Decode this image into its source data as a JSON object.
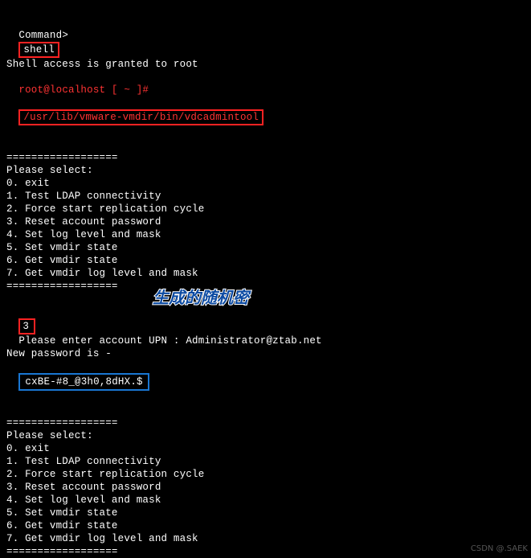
{
  "top": {
    "prompt_label": "Command>",
    "command": "shell",
    "access_msg": "Shell access is granted to root",
    "shell_prompt": "root@localhost [ ~ ]#",
    "shell_command": "/usr/lib/vmware-vmdir/bin/vdcadmintool"
  },
  "separator": "==================",
  "menu1": {
    "title": "Please select:",
    "opt0": "0. exit",
    "opt1": "1. Test LDAP connectivity",
    "opt2": "2. Force start replication cycle",
    "opt3": "3. Reset account password",
    "opt4": "4. Set log level and mask",
    "opt5": "5. Set vmdir state",
    "opt6": "6. Get vmdir state",
    "opt7": "7. Get vmdir log level and mask"
  },
  "input_choice": "3",
  "upn_line": "  Please enter account UPN : Administrator@ztab.net",
  "newpwd_label": "New password is -",
  "newpwd_value": "cxBE-#8_@3h0,8dHX.$",
  "annotation_text": "生成的随机密",
  "menu2": {
    "title": "Please select:",
    "opt0": "0. exit",
    "opt1": "1. Test LDAP connectivity",
    "opt2": "2. Force start replication cycle",
    "opt3": "3. Reset account password",
    "opt4": "4. Set log level and mask",
    "opt5": "5. Set vmdir state",
    "opt6": "6. Get vmdir state",
    "opt7": "7. Get vmdir log level and mask"
  },
  "watermark": "CSDN @.SAEK"
}
